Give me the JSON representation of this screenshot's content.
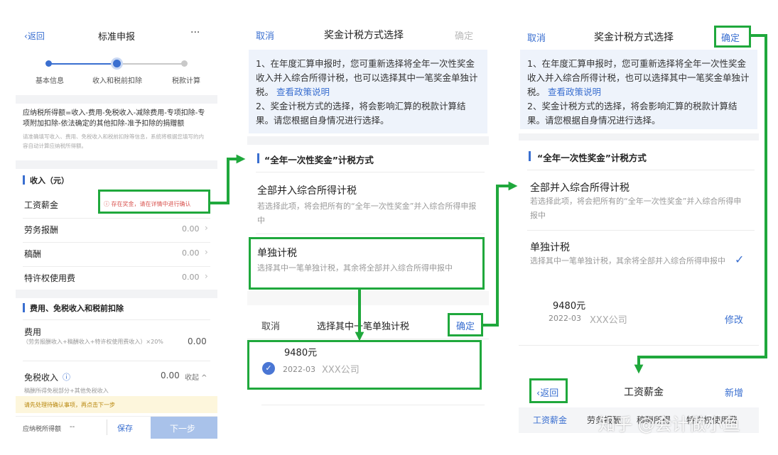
{
  "s1": {
    "back": "返回",
    "title": "标准申报",
    "more": "···",
    "steps": [
      "基本信息",
      "收入和税前扣除",
      "税款计算"
    ],
    "formula": "应纳税所得额=收入-费用-免税收入-减除费用-专项扣除-专项附加扣除-依法确定的其他扣除-准予扣除的捐赠额",
    "formula_note": "请准确填写收入、费用、免税收入和税前扣除等信息，系统将根据您填写的内容自动计算应纳税所得额。",
    "income_header": "收入（元）",
    "salary_label": "工资薪金",
    "salary_warn": "存在奖金，请在详情中进行确认",
    "rows": [
      {
        "label": "劳务报酬",
        "value": "0.00"
      },
      {
        "label": "稿酬",
        "value": "0.00"
      },
      {
        "label": "特许权使用费",
        "value": "0.00"
      }
    ],
    "deduct_header": "费用、免税收入和税前扣除",
    "fee_label": "费用",
    "fee_note": "（劳务报酬收入+稿酬收入+特许权使用费收入）×20%",
    "fee_value": "0.00",
    "exempt_label": "免税收入",
    "exempt_value": "0.00",
    "exempt_toggle": "收起",
    "exempt_note": "稿酬所得免税部分+其他免税收入",
    "yellow_tip": "请先处理待确认事项，再点击下一步",
    "taxable_label": "应纳税所得额",
    "taxable_value": "--",
    "save": "保存",
    "next": "下一步"
  },
  "s2": {
    "cancel": "取消",
    "title": "奖金计税方式选择",
    "confirm": "确定",
    "info1": "1、在年度汇算申报时，您可重新选择将全年一次性奖金收入并入综合所得计税，也可以选择其中一笔奖金单独计税。",
    "policy_link": "查看政策说明",
    "info2": "2、奖金计税方式的选择，将会影响汇算的税款计算结果。请您根据自身情况进行选择。",
    "section": "“全年一次性奖金”计税方式",
    "opt1_title": "全部并入综合所得计税",
    "opt1_desc": "若选择此项，将会把所有的“全年一次性奖金”并入综合所得申报中",
    "opt2_title": "单独计税",
    "opt2_desc": "选择其中一笔单独计税，其余将全部并入综合所得申报中",
    "sheet_cancel": "取消",
    "sheet_title": "选择其中一笔单独计税",
    "sheet_confirm": "确定",
    "item_amount": "9480元",
    "item_date": "2022-03",
    "item_company": "XXX公司"
  },
  "s3": {
    "cancel": "取消",
    "title": "奖金计税方式选择",
    "confirm": "确定",
    "info1": "1、在年度汇算申报时，您可重新选择将全年一次性奖金收入并入综合所得计税，也可以选择其中一笔奖金单独计税。",
    "policy_link": "查看政策说明",
    "info2": "2、奖金计税方式的选择，将会影响汇算的税款计算结果。请您根据自身情况进行选择。",
    "section": "“全年一次性奖金”计税方式",
    "opt1_title": "全部并入综合所得计税",
    "opt1_desc": "若选择此项，将会把所有的“全年一次性奖金”并入综合所得申报中",
    "opt2_title": "单独计税",
    "opt2_desc": "选择其中一笔单独计税，其余将全部并入综合所得申报中",
    "item_amount": "9480元",
    "item_date": "2022-03",
    "item_company": "XXX公司",
    "modify": "修改"
  },
  "s4": {
    "back": "返回",
    "title": "工资薪金",
    "add": "新增",
    "tabs": [
      "工资薪金",
      "劳务报酬",
      "稿酬所得",
      "特许权使用费"
    ]
  },
  "watermark": "知乎 @会计做小鱼",
  "colors": {
    "accent": "#3a6fd0",
    "highlight": "#1fa83c",
    "warn": "#d9534f",
    "tip_bg": "#fdf6dc"
  }
}
